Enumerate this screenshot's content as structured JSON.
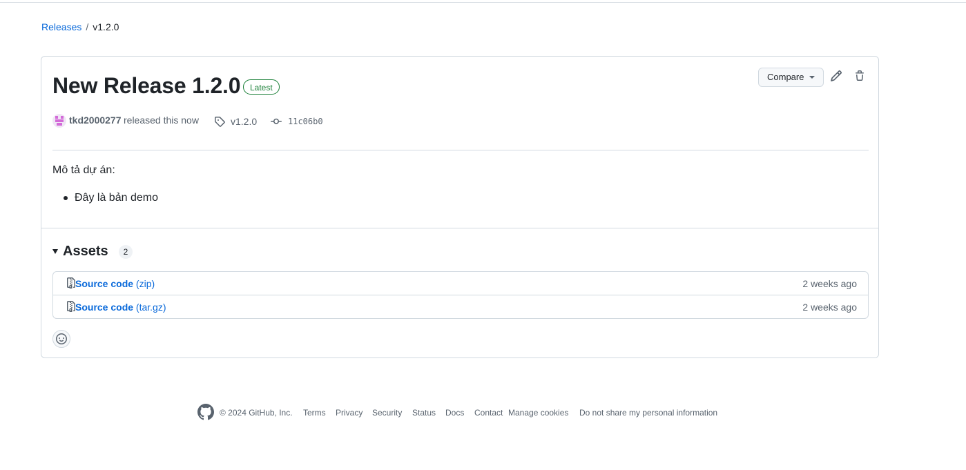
{
  "breadcrumb": {
    "root": "Releases",
    "separator": "/",
    "current": "v1.2.0"
  },
  "release": {
    "title": "New Release 1.2.0",
    "badge": "Latest",
    "compare_label": "Compare",
    "edit_icon": "pencil-icon",
    "delete_icon": "trash-icon",
    "author": "tkd2000277",
    "released_text": "released this now",
    "tag": "v1.2.0",
    "commit": "11c06b0"
  },
  "description": {
    "heading": "Mô tả dự án:",
    "items": [
      "Đây là bản demo"
    ]
  },
  "assets": {
    "title": "Assets",
    "count": "2",
    "items": [
      {
        "name": "Source code",
        "ext": "(zip)",
        "time": "2 weeks ago",
        "icon": "file-zip-icon"
      },
      {
        "name": "Source code",
        "ext": "(tar.gz)",
        "time": "2 weeks ago",
        "icon": "file-zip-icon"
      }
    ]
  },
  "reactions": {
    "icon": "smiley-icon"
  },
  "footer": {
    "copyright": "© 2024 GitHub, Inc.",
    "links": [
      "Terms",
      "Privacy",
      "Security",
      "Status",
      "Docs",
      "Contact",
      "Manage cookies",
      "Do not share my personal information"
    ]
  },
  "colors": {
    "link": "#0969da",
    "latest_badge": "#1a7f37",
    "muted_text": "#59636e",
    "border": "#d1d9e0"
  }
}
